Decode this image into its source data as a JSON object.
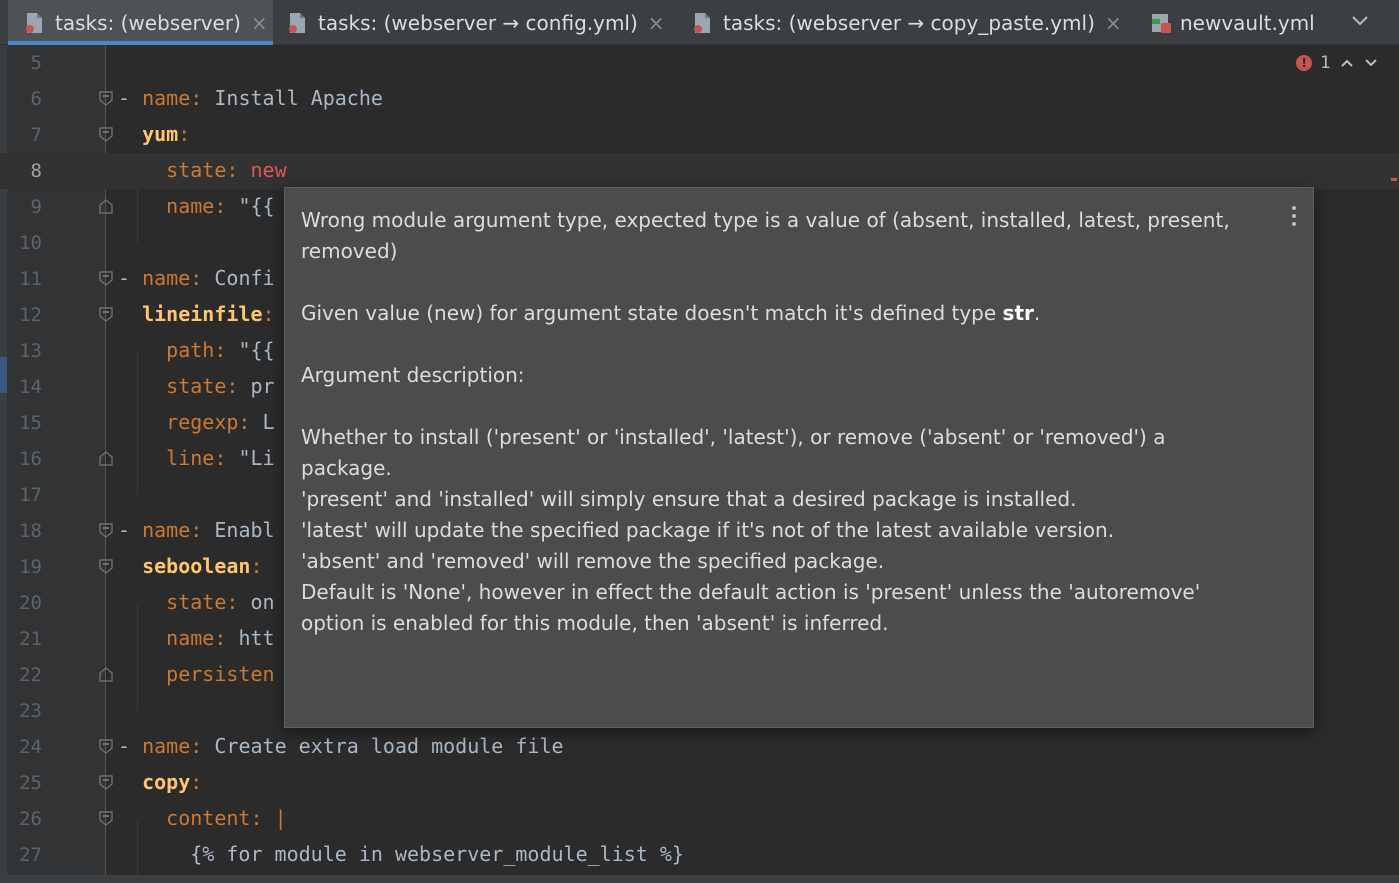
{
  "tabs": [
    {
      "label": "tasks: (webserver)",
      "active": true,
      "icon": "yaml-file-icon"
    },
    {
      "label": "tasks: (webserver → config.yml)",
      "active": false,
      "icon": "yaml-file-icon"
    },
    {
      "label": "tasks: (webserver → copy_paste.yml)",
      "active": false,
      "icon": "yaml-file-icon"
    },
    {
      "label": "newvault.yml",
      "active": false,
      "icon": "vault-file-icon"
    }
  ],
  "tab_close_glyph": "×",
  "problems": {
    "error_count": "1",
    "error_glyph": "!"
  },
  "lines": [
    {
      "n": "5"
    },
    {
      "n": "6",
      "dash": "- ",
      "key": "name",
      "sep": ": ",
      "val": "Install Apache"
    },
    {
      "n": "7",
      "key_bold": "yum",
      "sep": ":"
    },
    {
      "n": "8",
      "key": "state",
      "sep": ": ",
      "err_val": "new"
    },
    {
      "n": "9",
      "key": "name",
      "sep": ": ",
      "val": "\"{{"
    },
    {
      "n": "10"
    },
    {
      "n": "11",
      "dash": "- ",
      "key": "name",
      "sep": ": ",
      "val": "Confi"
    },
    {
      "n": "12",
      "key_bold": "lineinfile",
      "sep": ":"
    },
    {
      "n": "13",
      "key": "path",
      "sep": ": ",
      "val": "\"{{"
    },
    {
      "n": "14",
      "key": "state",
      "sep": ": ",
      "val": "pr"
    },
    {
      "n": "15",
      "key": "regexp",
      "sep": ": ",
      "val": "L"
    },
    {
      "n": "16",
      "key": "line",
      "sep": ": ",
      "val": "\"Li"
    },
    {
      "n": "17"
    },
    {
      "n": "18",
      "dash": "- ",
      "key": "name",
      "sep": ": ",
      "val": "Enabl"
    },
    {
      "n": "19",
      "key_bold": "seboolean",
      "sep": ":"
    },
    {
      "n": "20",
      "key": "state",
      "sep": ": ",
      "val": "on"
    },
    {
      "n": "21",
      "key": "name",
      "sep": ": ",
      "val": "htt"
    },
    {
      "n": "22",
      "key": "persisten"
    },
    {
      "n": "23"
    },
    {
      "n": "24",
      "dash": "- ",
      "key": "name",
      "sep": ": ",
      "val": "Create extra load module file"
    },
    {
      "n": "25",
      "key_bold": "copy",
      "sep": ":"
    },
    {
      "n": "26",
      "key": "content",
      "sep": ": ",
      "val": "|"
    },
    {
      "n": "27",
      "val": "{% for module in webserver_module_list %}"
    }
  ],
  "popup": {
    "line1": "Wrong module argument type, expected type is a value of (absent, installed, latest, present, removed)",
    "line2_pre": "Given value (new) for argument state doesn't match it's defined type ",
    "line2_type": "str",
    "line2_post": ".",
    "line3": "Argument description:",
    "desc1": "Whether to install ('present' or 'installed', 'latest'), or remove ('absent' or 'removed') a package.",
    "desc2": "'present' and 'installed' will simply ensure that a desired package is installed.",
    "desc3": "'latest' will update the specified package if it's not of the latest available version.",
    "desc4": "'absent' and 'removed' will remove the specified package.",
    "desc5": "Default is 'None', however in effect the default action is 'present' unless the 'autoremove' option is enabled for this module, then 'absent' is inferred."
  },
  "colors": {
    "keyword": "#cc7832",
    "value": "#a9b7c6",
    "error": "#e05555",
    "accent": "#4a88c7",
    "popup_bg": "#4b4d4d"
  }
}
